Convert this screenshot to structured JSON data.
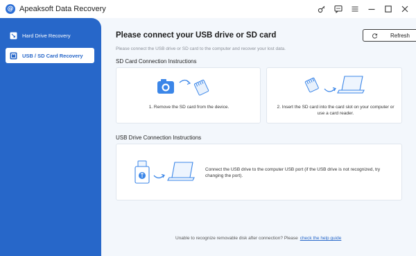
{
  "window": {
    "title": "Apeaksoft Data Recovery",
    "logo_glyph": "@"
  },
  "sidebar": {
    "items": [
      {
        "label": "Hard Drive Recovery",
        "active": false,
        "icon": "hard-drive-icon"
      },
      {
        "label": "USB / SD Card Recovery",
        "active": true,
        "icon": "sd-card-icon"
      }
    ]
  },
  "main": {
    "title": "Please connect your USB drive or SD card",
    "subtitle": "Please connect the USB drive or SD card to the computer and recover your lost data.",
    "refresh_label": "Refresh",
    "sd_section_title": "SD Card Connection Instructions",
    "sd_steps": [
      "1. Remove the SD card from the device.",
      "2. Insert the SD card into the card slot on your computer or use a card reader."
    ],
    "usb_section_title": "USB Drive Connection Instructions",
    "usb_step": "Connect the USB drive to the computer USB port (if the USB drive is not recognized, try changing the port).",
    "footer_text": "Unable to recognize removable disk after connection? Please",
    "footer_link": "check the help guide"
  },
  "colors": {
    "accent": "#2767c9",
    "background": "#f3f7fc",
    "illustration": "#3b86e8"
  }
}
